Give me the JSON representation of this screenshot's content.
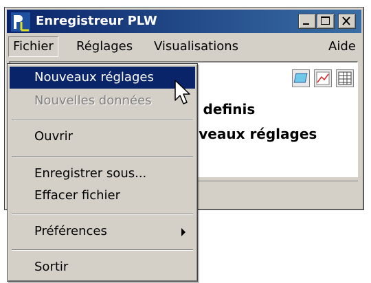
{
  "window": {
    "title": "Enregistreur PLW",
    "minimize_glyph": "_",
    "maximize_glyph": "□",
    "close_glyph": "×"
  },
  "menubar": {
    "items": [
      {
        "label": "Fichier"
      },
      {
        "label": "Réglages"
      },
      {
        "label": "Visualisations"
      },
      {
        "label": "Aide"
      }
    ]
  },
  "content": {
    "line1": "e definis",
    "line2": "uveaux réglages"
  },
  "dropdown": {
    "items": [
      {
        "label": "Nouveaux réglages",
        "state": "highlighted"
      },
      {
        "label": "Nouvelles données",
        "state": "disabled"
      },
      {
        "label": "Ouvrir",
        "state": "normal"
      },
      {
        "label": "Enregistrer sous...",
        "state": "normal"
      },
      {
        "label": "Effacer fichier",
        "state": "normal"
      },
      {
        "label": "Préférences",
        "state": "normal",
        "submenu": true
      },
      {
        "label": "Sortir",
        "state": "normal"
      }
    ]
  },
  "icons": [
    "app-logo-icon",
    "oscilloscope-view-icon",
    "graph-view-icon",
    "table-view-icon"
  ],
  "colors": {
    "titlebar_start": "#0a246a",
    "titlebar_end": "#3a6ea5",
    "highlight": "#0a246a",
    "face": "#d4d0c8"
  }
}
